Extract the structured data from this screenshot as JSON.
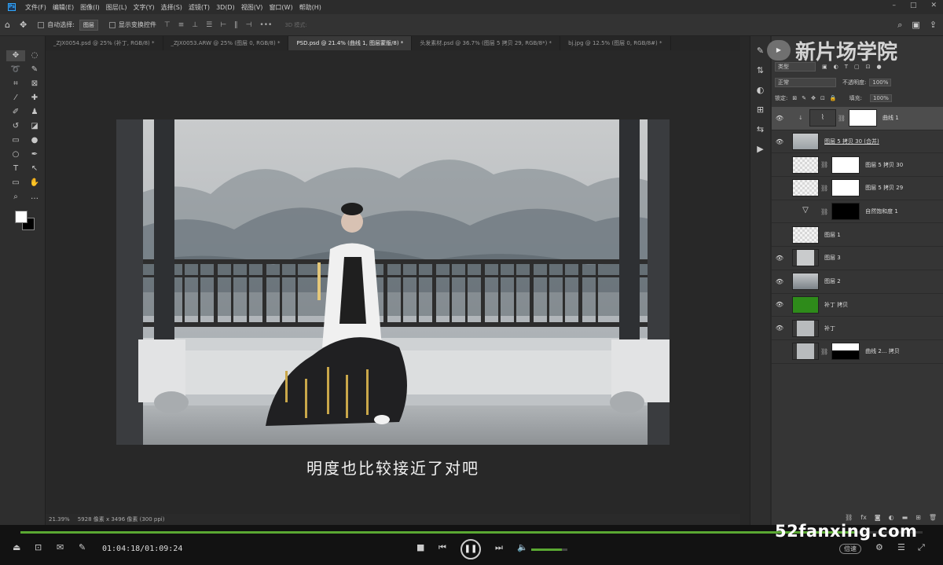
{
  "menubar": {
    "items": [
      "文件(F)",
      "编辑(E)",
      "图像(I)",
      "图层(L)",
      "文字(Y)",
      "选择(S)",
      "滤镜(T)",
      "3D(D)",
      "视图(V)",
      "窗口(W)",
      "帮助(H)"
    ]
  },
  "options": {
    "auto_select_label": "自动选择:",
    "auto_select_value": "图层",
    "show_transform_label": "显示变换控件",
    "mode_3d": "3D 模式:"
  },
  "tabs": [
    "_ZJX0054.psd @ 25% (补丁, RGB/8) *",
    "_ZJX0053.ARW @ 25% (图层 0, RGB/8) *",
    "PSD.psd @ 21.4% (曲线 1, 图层蒙版/8) *",
    "头发素材.psd @ 36.7% (图层 5 拷贝 29, RGB/8*) *",
    "bj.jpg @ 12.5% (图层 0, RGB/8#) *"
  ],
  "canvas": {
    "subtitle": "明度也比较接近了对吧"
  },
  "status": {
    "zoom": "21.39%",
    "doc_info": "5928 像素 x 3496 像素 (300 ppi)"
  },
  "watermark": {
    "text": "新片场学院",
    "site": "52fanxing.com"
  },
  "layers_panel": {
    "filter_label": "类型",
    "blend_mode": "正常",
    "opacity_label": "不透明度:",
    "opacity_value": "100%",
    "lock_label": "锁定:",
    "fill_label": "填充:",
    "fill_value": "100%",
    "layers": [
      {
        "name": "曲线 1",
        "visible": true,
        "active": true
      },
      {
        "name": "图层 5 拷贝 30 (合并)",
        "visible": true,
        "active": false
      },
      {
        "name": "图层 5 拷贝 30",
        "visible": false,
        "active": false
      },
      {
        "name": "图层 5 拷贝 29",
        "visible": false,
        "active": false
      },
      {
        "name": "自然饱和度 1",
        "visible": false,
        "active": false
      },
      {
        "name": "图层 1",
        "visible": false,
        "active": false
      },
      {
        "name": "图层 3",
        "visible": true,
        "active": false
      },
      {
        "name": "图层 2",
        "visible": true,
        "active": false
      },
      {
        "name": "补丁 拷贝",
        "visible": true,
        "active": false
      },
      {
        "name": "补丁",
        "visible": true,
        "active": false
      },
      {
        "name": "曲线 2... 拷贝",
        "visible": false,
        "active": false
      }
    ]
  },
  "player": {
    "time": "01:04:18/01:09:24",
    "progress": 0.925,
    "volume": 0.85,
    "speed_label": "倍速"
  },
  "colors": {
    "accent_green": "#5aa832",
    "ps_blue": "#31a8ff",
    "green_layer": "#2e8b1a"
  }
}
